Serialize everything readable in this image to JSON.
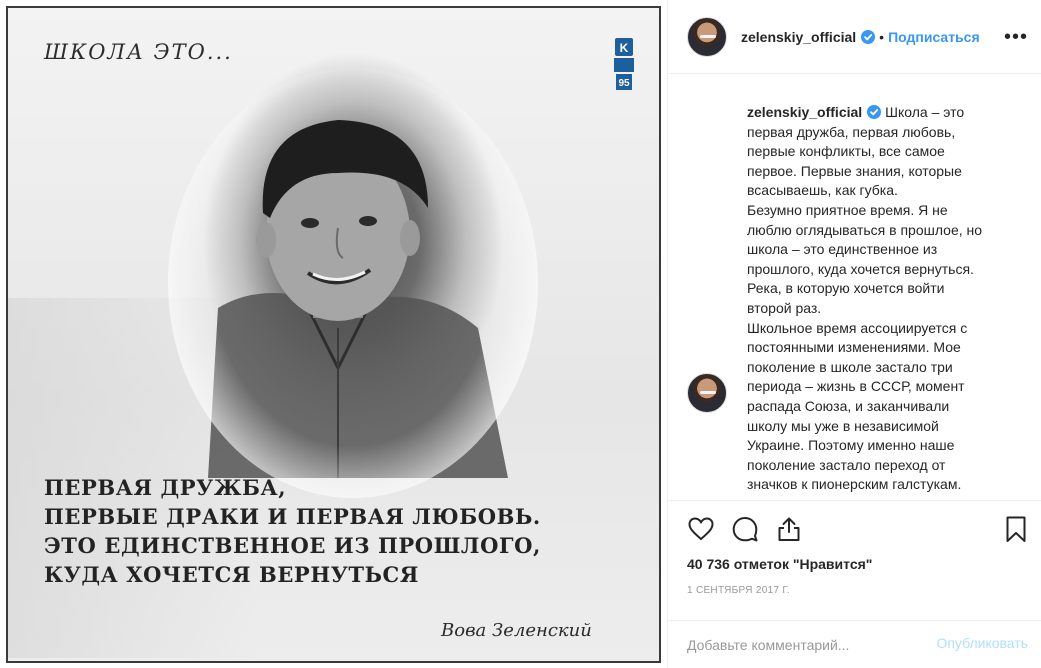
{
  "post_image": {
    "heading": "ШКОЛА  ЭТО...",
    "logo_text": "КВАРТАЛ",
    "logo_number": "95",
    "quote_lines": [
      "ПЕРВАЯ ДРУЖБА,",
      "ПЕРВЫЕ ДРАКИ И ПЕРВАЯ ЛЮБОВЬ.",
      "ЭТО ЕДИНСТВЕННОЕ ИЗ ПРОШЛОГО,",
      "КУДА ХОЧЕТСЯ ВЕРНУТЬСЯ"
    ],
    "signature": "Вова Зеленский"
  },
  "header": {
    "username": "zelenskiy_official",
    "separator": "•",
    "follow_label": "Подписаться",
    "more_label": "•••"
  },
  "caption": {
    "username": "zelenskiy_official",
    "lines": [
      "Школа – это",
      "первая дружба, первая любовь,",
      "первые конфликты, все самое",
      "первое. Первые знания, которые",
      "всасываешь, как губка.",
      "Безумно приятное время. Я не",
      "люблю оглядываться в прошлое, но",
      "школа – это единственное из",
      "прошлого, куда хочется вернуться.",
      "Река, в которую хочется войти",
      "второй раз.",
      "Школьное время ассоциируется с",
      "постоянными изменениями. Мое",
      "поколение в школе застало три",
      "периода – жизнь в СССР, момент",
      "распада Союза, и заканчивали",
      "школу мы уже в независимой",
      "Украине. Поэтому именно наше",
      "поколение застало переход от",
      "значков к пионерским галстукам."
    ]
  },
  "stats": {
    "likes": "40 736 отметок \"Нравится\"",
    "date": "1 СЕНТЯБРЯ 2017 Г."
  },
  "comment_box": {
    "placeholder": "Добавьте комментарий...",
    "publish_label": "Опубликовать"
  },
  "colors": {
    "accent": "#3897f0",
    "publish_disabled": "#b2dffc",
    "muted": "#999999",
    "text": "#262626"
  }
}
